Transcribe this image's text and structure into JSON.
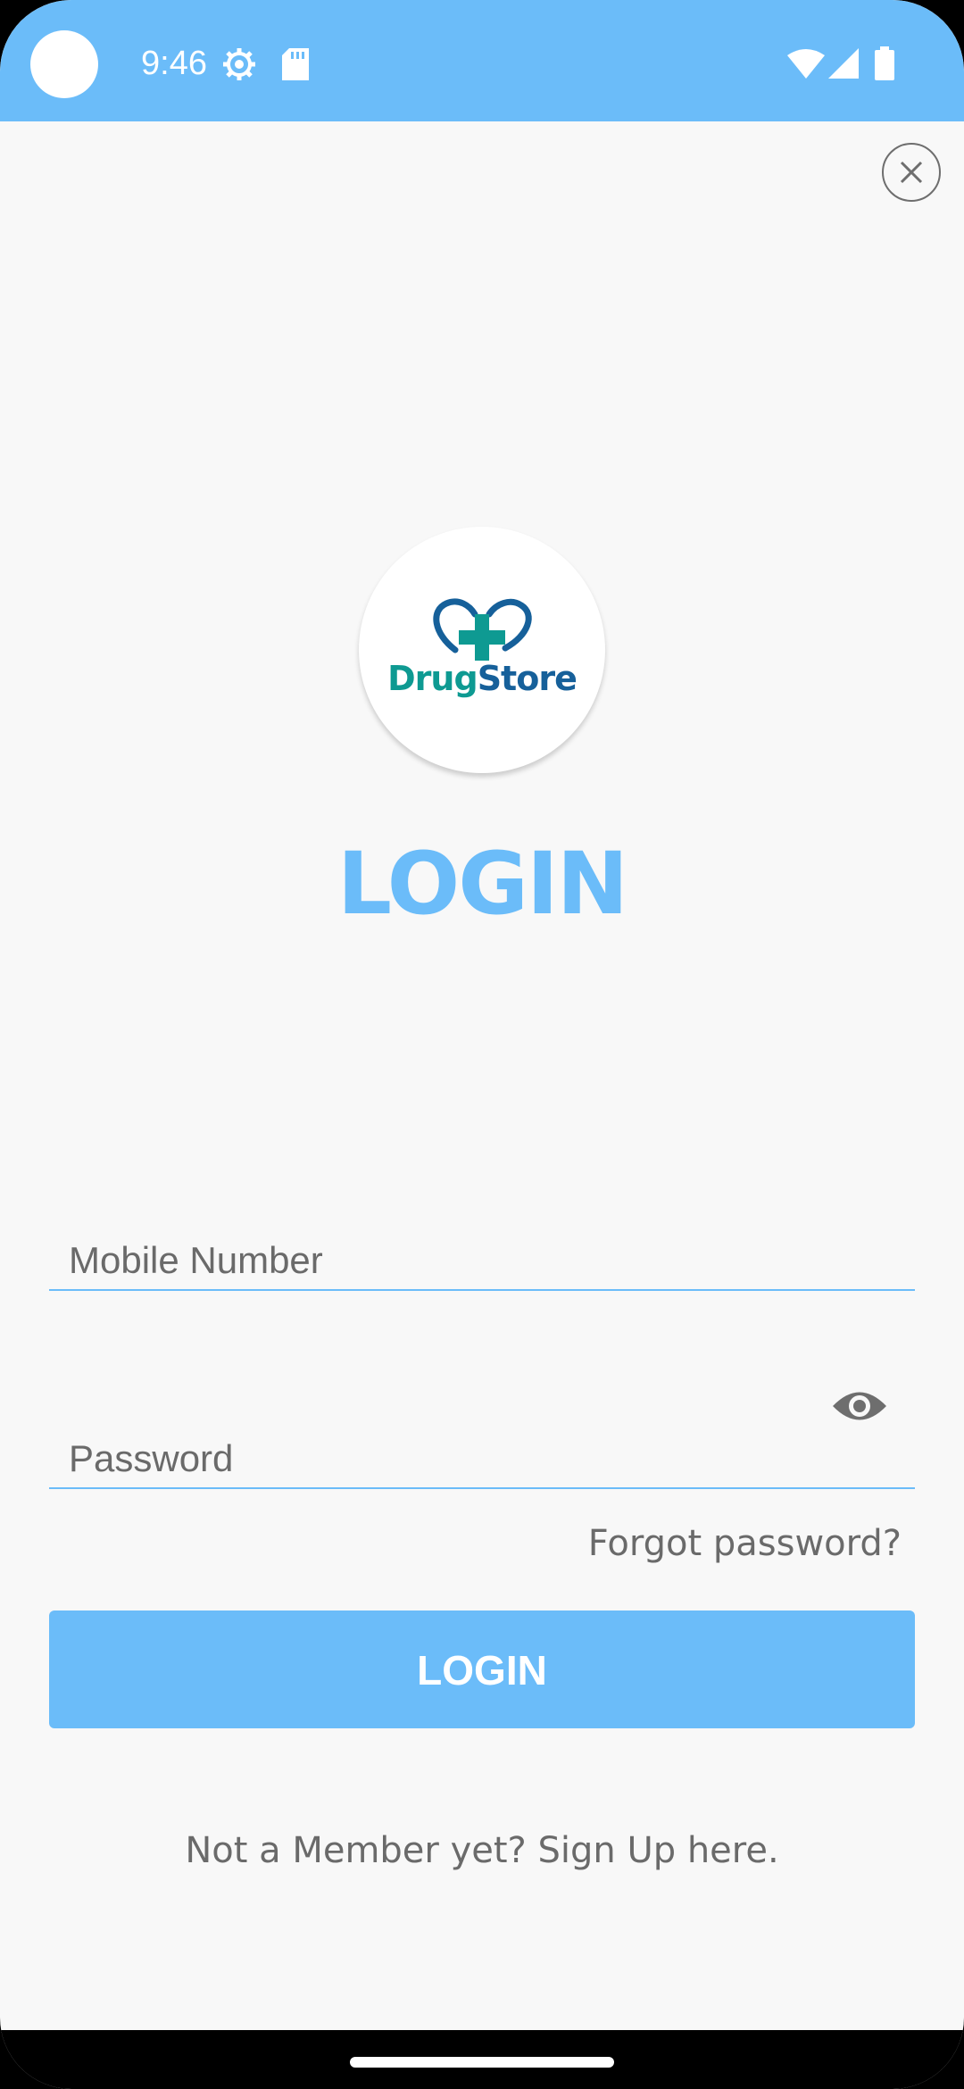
{
  "status_bar": {
    "time": "9:46",
    "icons": [
      "settings-gear-icon",
      "sd-card-icon",
      "wifi-icon",
      "signal-icon",
      "battery-icon"
    ],
    "background_color": "#6bbcf9"
  },
  "close_button": {
    "icon": "close-icon"
  },
  "logo": {
    "brand_part1": "Drug",
    "brand_part2": "Store",
    "icon": "heart-cross-icon"
  },
  "title": "LOGIN",
  "form": {
    "mobile": {
      "placeholder": "Mobile Number",
      "value": ""
    },
    "password": {
      "placeholder": "Password",
      "value": "",
      "toggle_icon": "eye-icon"
    },
    "forgot_password": "Forgot password?",
    "login_button": "LOGIN"
  },
  "signup_text": "Not a Member yet? Sign Up here.",
  "accent_color": "#6bbcf9"
}
